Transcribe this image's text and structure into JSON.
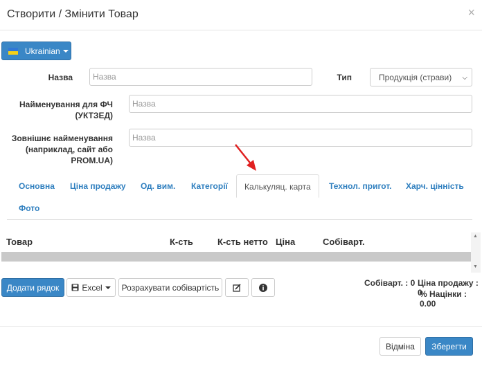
{
  "header": {
    "title": "Створити / Змінити Товар",
    "close": "×"
  },
  "language": {
    "label": "Ukrainian"
  },
  "form": {
    "name_label": "Назва",
    "name_placeholder": "Назва",
    "type_label": "Тип",
    "type_value": "Продукція (страви)",
    "fc_name_label_line1": "Найменування для ФЧ",
    "fc_name_label_line2": "(УКТЗЕД)",
    "fc_name_placeholder": "Назва",
    "ext_name_label_line1": "Зовнішнє найменування",
    "ext_name_label_line2": "(наприклад, сайт або",
    "ext_name_label_line3": "PROM.UA)",
    "ext_name_placeholder": "Назва"
  },
  "tabs": [
    {
      "label": "Основна"
    },
    {
      "label": "Ціна продажу"
    },
    {
      "label": "Од. вим."
    },
    {
      "label": "Категорії"
    },
    {
      "label": "Калькуляц. карта"
    },
    {
      "label": "Технол. пригот."
    },
    {
      "label": "Харч. цінність"
    },
    {
      "label": "Фото"
    }
  ],
  "active_tab": "Калькуляц. карта",
  "table": {
    "columns": [
      "Товар",
      "К-сть",
      "К-сть нетто",
      "Ціна",
      "Собіварт."
    ]
  },
  "toolbar": {
    "add_row": "Додати рядок",
    "excel": "Excel",
    "calc_cost": "Розрахувати собівартість",
    "edit_icon": "edit-icon",
    "info_icon": "info-icon"
  },
  "totals": {
    "cost": "Собіварт. : 0",
    "sale_price": "Ціна продажу : 0",
    "markup": "% Націнки : 0.00"
  },
  "footer": {
    "cancel": "Відміна",
    "save": "Зберегти"
  },
  "colors": {
    "primary": "#3a87c6",
    "link": "#2f7fbf",
    "arrow": "#e02020"
  }
}
